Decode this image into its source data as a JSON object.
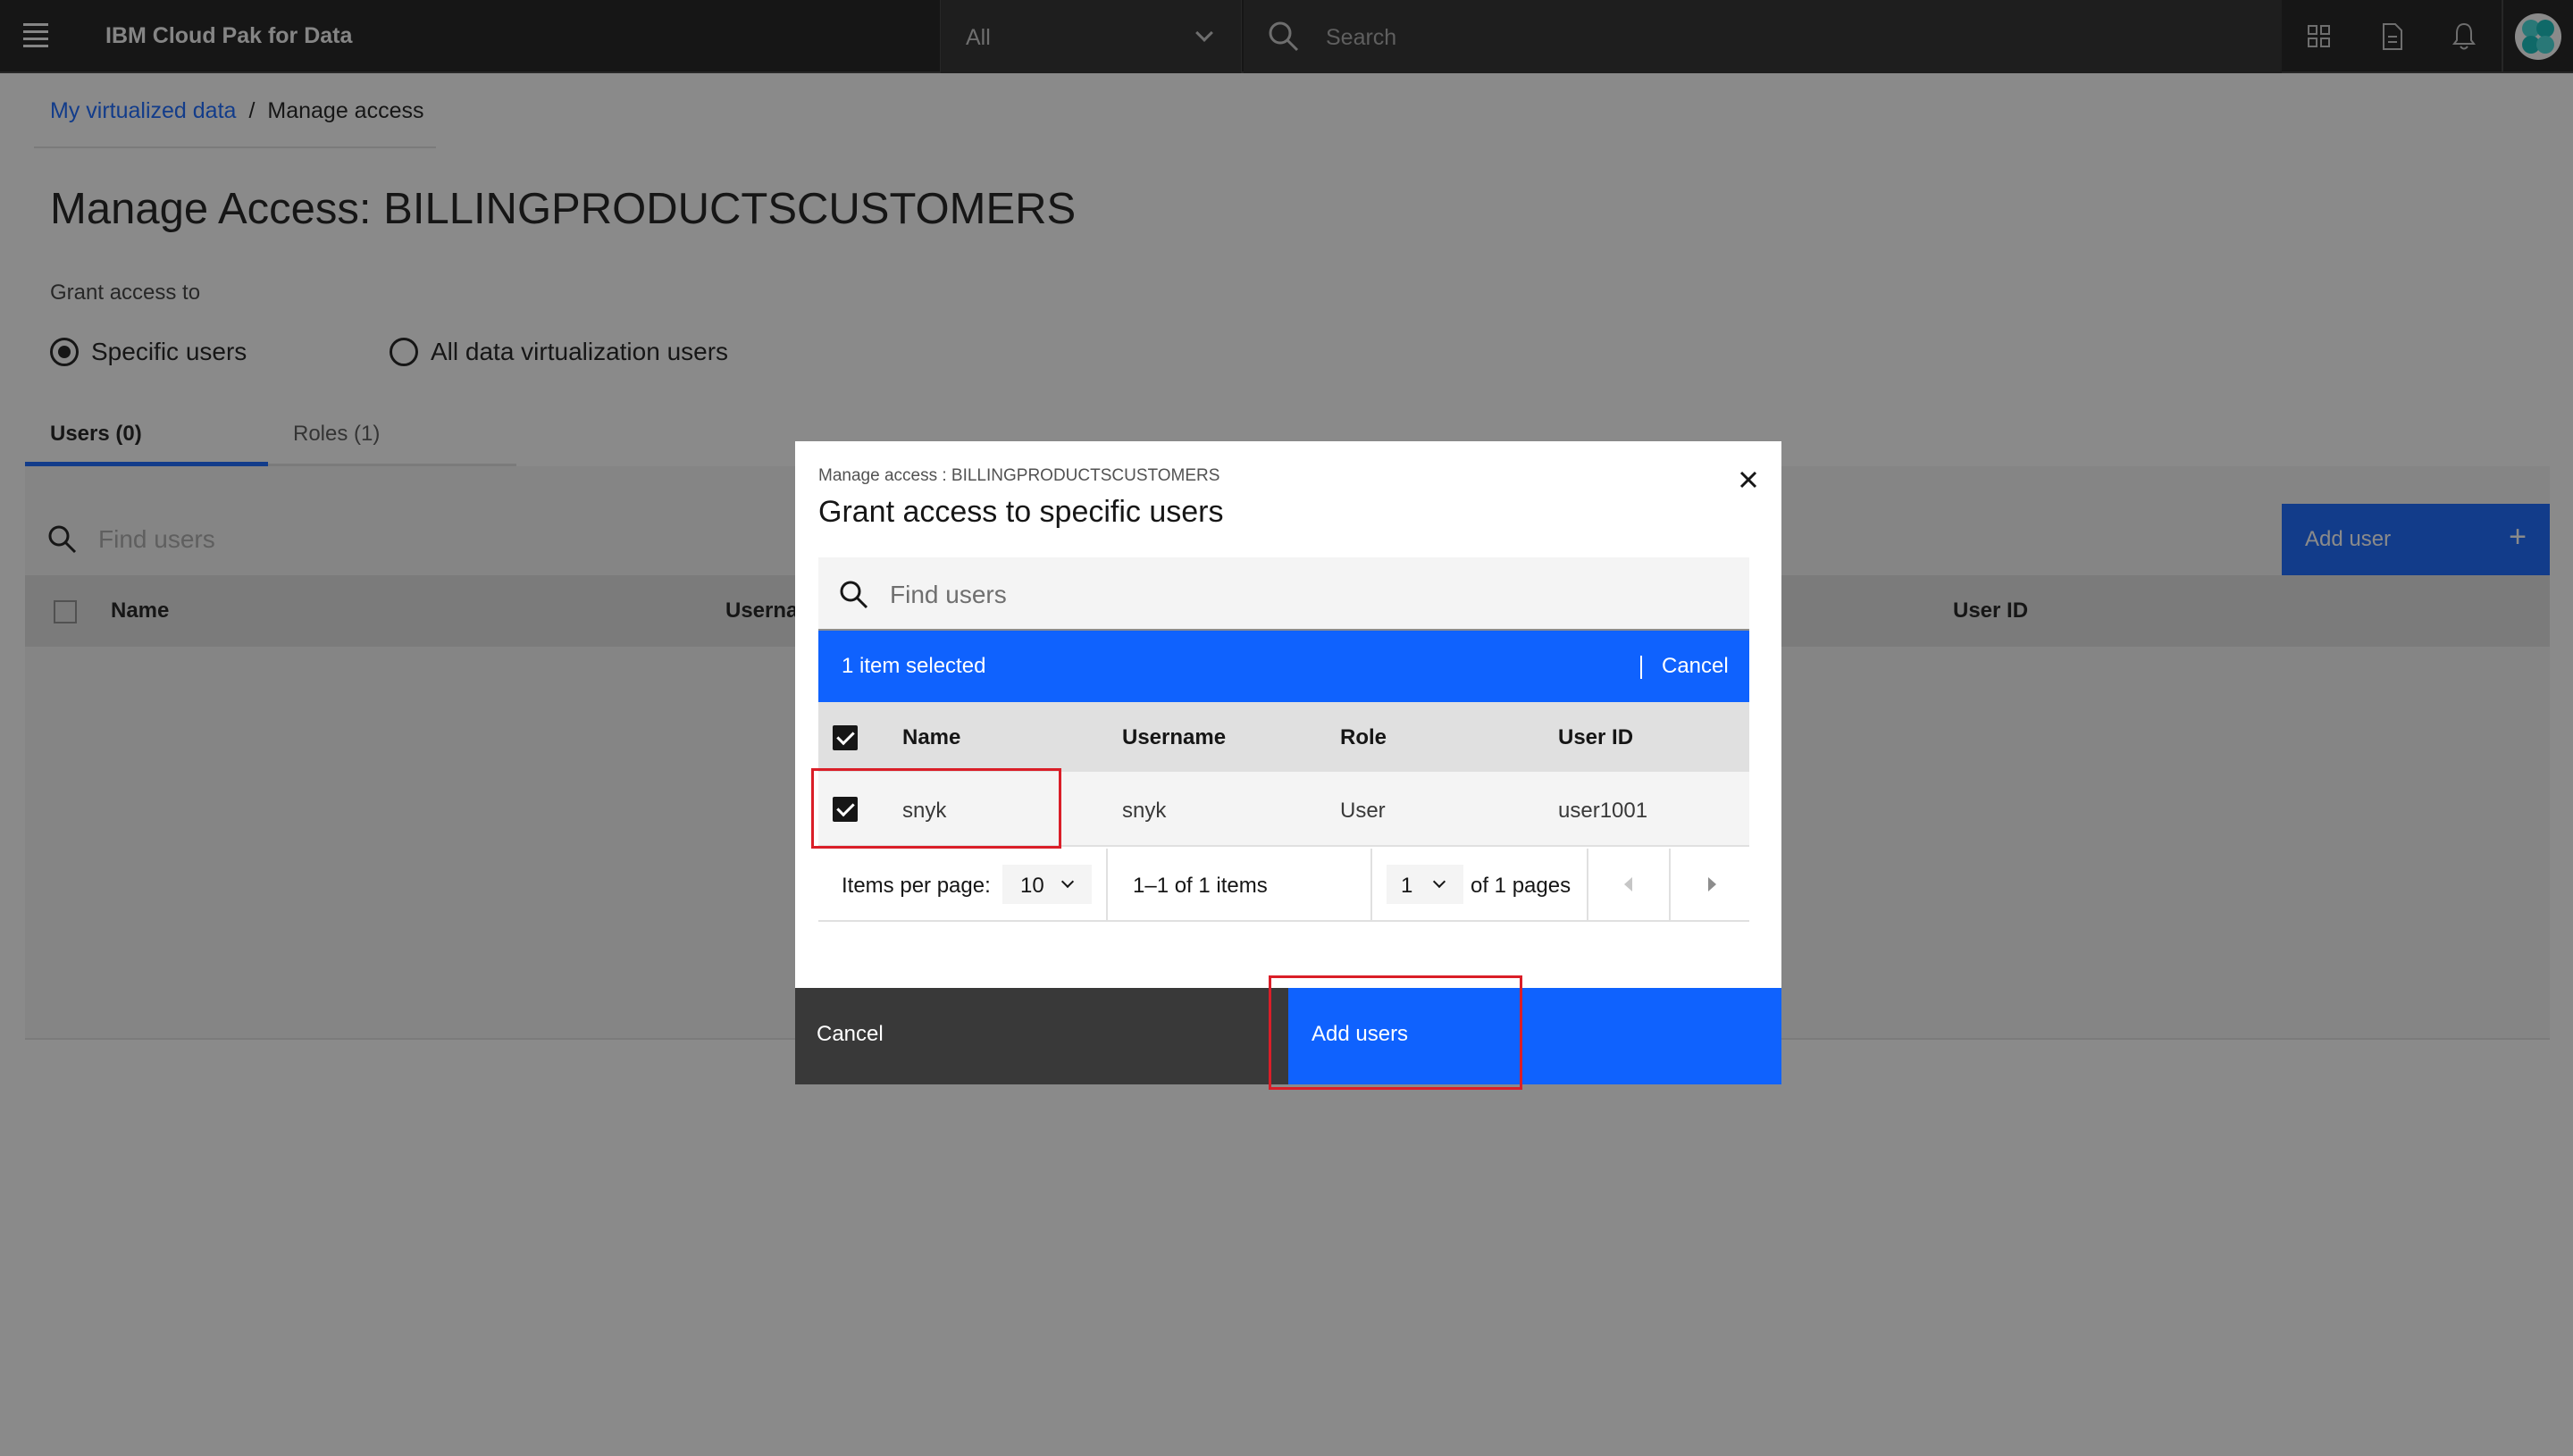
{
  "header": {
    "brand": "IBM Cloud Pak for Data",
    "scope_value": "All",
    "search_placeholder": "Search"
  },
  "breadcrumb": {
    "parent": "My virtualized data",
    "separator": "/",
    "current": "Manage access"
  },
  "page": {
    "title": "Manage Access: BILLINGPRODUCTSCUSTOMERS",
    "grant_label": "Grant access to",
    "radio_specific": "Specific users",
    "radio_all": "All data virtualization users",
    "tab_users": "Users (0)",
    "tab_roles": "Roles (1)",
    "find_placeholder": "Find users",
    "add_user_label": "Add user",
    "columns": [
      "Name",
      "Userna",
      "User ID"
    ]
  },
  "modal": {
    "label": "Manage access : BILLINGPRODUCTSCUSTOMERS",
    "heading": "Grant access to specific users",
    "search_placeholder": "Find users",
    "selected_text": "1 item selected",
    "batch_cancel": "Cancel",
    "columns": [
      "Name",
      "Username",
      "Role",
      "User ID"
    ],
    "rows": [
      {
        "name": "snyk",
        "username": "snyk",
        "role": "User",
        "user_id": "user1001"
      }
    ],
    "pagination": {
      "items_per_page_label": "Items per page:",
      "items_per_page": "10",
      "range": "1–1 of 1 items",
      "page": "1",
      "of_pages": "of 1 pages"
    },
    "cancel_label": "Cancel",
    "add_label": "Add users"
  },
  "colors": {
    "primary": "#0f62fe",
    "header_bg": "#161616",
    "highlight": "#da1e28"
  }
}
